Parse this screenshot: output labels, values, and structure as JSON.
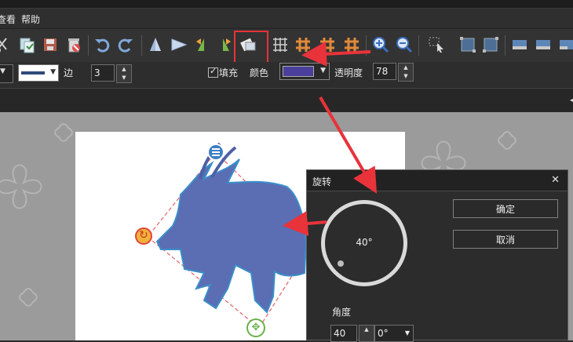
{
  "menubar": {
    "items": [
      "查看",
      "帮助"
    ]
  },
  "propbar": {
    "edge_label": "边",
    "edge_value": "3",
    "fill_label": "填充",
    "fill_checked": true,
    "color_label": "颜色",
    "color_value": "#4a3f9a",
    "opacity_label": "透明度",
    "opacity_value": "78"
  },
  "colors": {
    "accent_red": "#e8333a",
    "shape_fill": "#5b6db3",
    "selection": "#e8626a"
  },
  "canvas": {
    "handles": [
      "menu-icon",
      "rotate-icon",
      "resize-icon"
    ]
  },
  "dialog": {
    "title": "旋转",
    "close": "✕",
    "dial_value": "40°",
    "ok": "确定",
    "cancel": "取消",
    "angle_label": "角度",
    "angle_value": "40",
    "preset_value": "0°"
  }
}
